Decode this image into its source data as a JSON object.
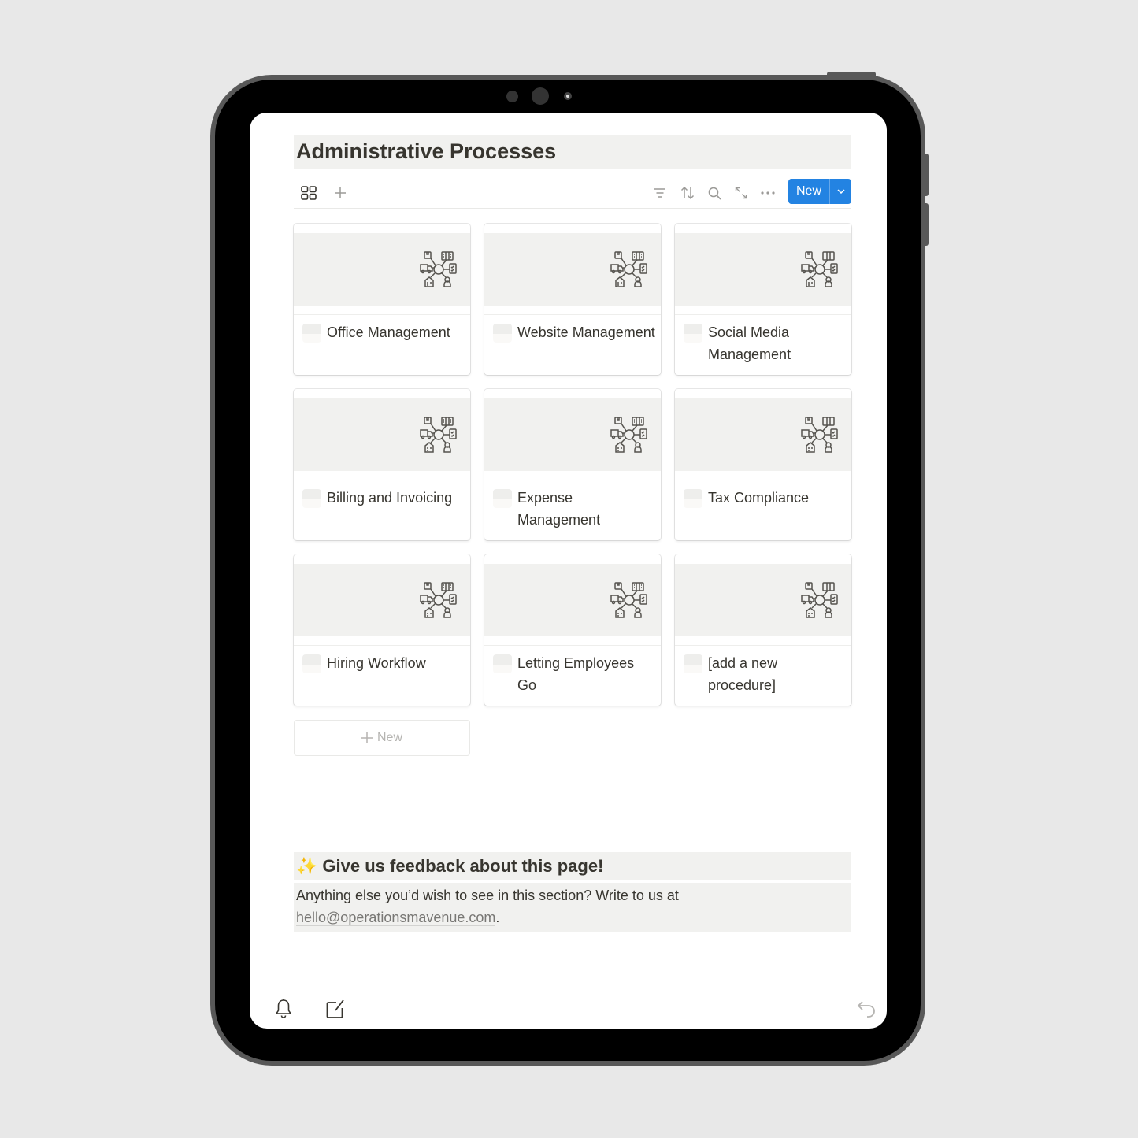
{
  "page": {
    "title": "Administrative Processes"
  },
  "toolbar": {
    "view_icon": "gallery-grid-icon",
    "add_view_icon": "plus-icon",
    "icons": [
      "filter-icon",
      "sort-icon",
      "search-icon",
      "expand-icon",
      "more-icon"
    ],
    "new_label": "New",
    "new_dropdown_icon": "chevron-down-icon"
  },
  "cards": [
    {
      "title": "Office Management"
    },
    {
      "title": "Website Management"
    },
    {
      "title": "Social Media Management"
    },
    {
      "title": "Billing and Invoicing"
    },
    {
      "title": "Expense Management"
    },
    {
      "title": "Tax Compliance"
    },
    {
      "title": "Hiring Workflow"
    },
    {
      "title": "Letting Employees Go"
    },
    {
      "title": "[add a new procedure]"
    }
  ],
  "gallery": {
    "add_new_label": "New"
  },
  "feedback": {
    "emoji": "✨",
    "heading": "Give us feedback about this page!",
    "body_text": "Anything else you’d wish to see in this section? Write to us at",
    "email": "hello@operationsmavenue.com",
    "trailing": "."
  },
  "bottom_bar": {
    "icons": [
      "bell-icon",
      "compose-icon",
      "undo-icon"
    ]
  }
}
